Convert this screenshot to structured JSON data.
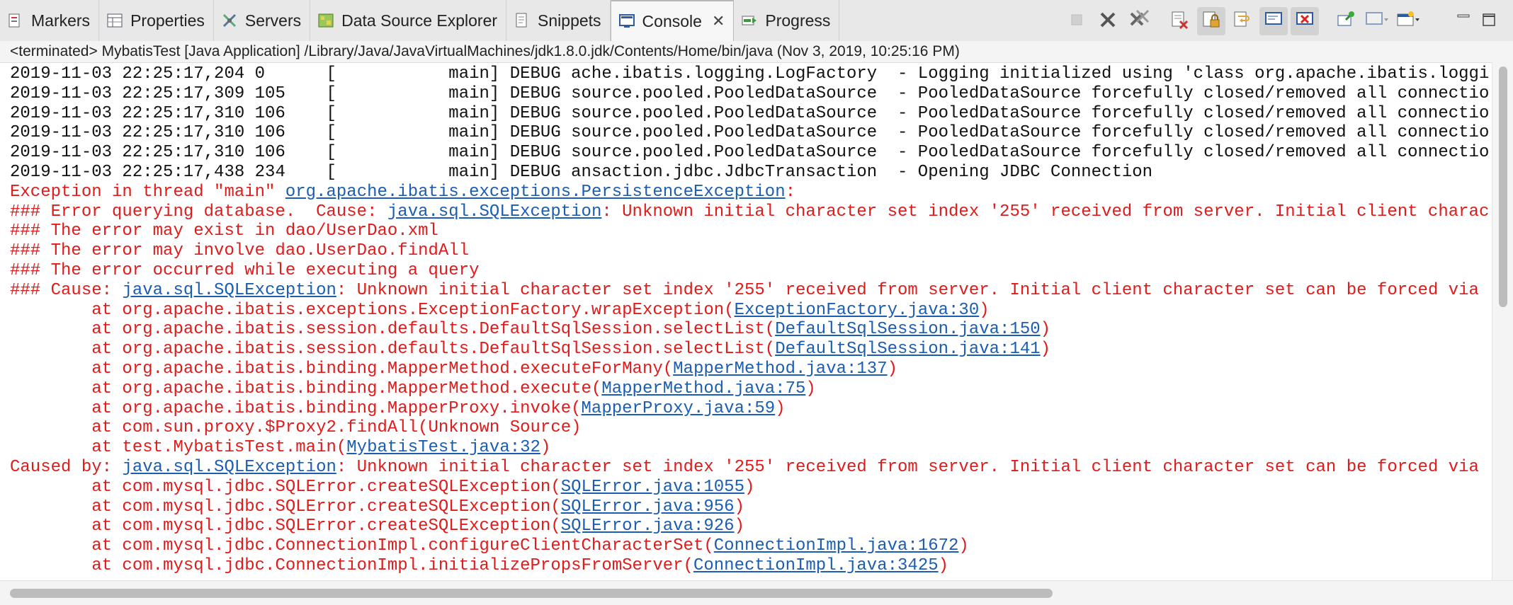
{
  "tabs": [
    {
      "label": "Markers",
      "icon": "markers-icon"
    },
    {
      "label": "Properties",
      "icon": "properties-icon"
    },
    {
      "label": "Servers",
      "icon": "servers-icon"
    },
    {
      "label": "Data Source Explorer",
      "icon": "data-source-icon"
    },
    {
      "label": "Snippets",
      "icon": "snippets-icon"
    },
    {
      "label": "Console",
      "icon": "console-icon",
      "active": true,
      "close": "✕"
    },
    {
      "label": "Progress",
      "icon": "progress-icon"
    }
  ],
  "status": "<terminated> MybatisTest [Java Application] /Library/Java/JavaVirtualMachines/jdk1.8.0.jdk/Contents/Home/bin/java (Nov 3, 2019, 10:25:16 PM)",
  "console_lines": [
    [
      {
        "t": "2019-11-03 22:25:17,204 0      [           main] DEBUG ache.ibatis.logging.LogFactory  - Logging initialized using 'class org.apache.ibatis.loggi",
        "c": "dbg"
      }
    ],
    [
      {
        "t": "2019-11-03 22:25:17,309 105    [           main] DEBUG source.pooled.PooledDataSource  - PooledDataSource forcefully closed/removed all connectio",
        "c": "dbg"
      }
    ],
    [
      {
        "t": "2019-11-03 22:25:17,310 106    [           main] DEBUG source.pooled.PooledDataSource  - PooledDataSource forcefully closed/removed all connectio",
        "c": "dbg"
      }
    ],
    [
      {
        "t": "2019-11-03 22:25:17,310 106    [           main] DEBUG source.pooled.PooledDataSource  - PooledDataSource forcefully closed/removed all connectio",
        "c": "dbg"
      }
    ],
    [
      {
        "t": "2019-11-03 22:25:17,310 106    [           main] DEBUG source.pooled.PooledDataSource  - PooledDataSource forcefully closed/removed all connectio",
        "c": "dbg"
      }
    ],
    [
      {
        "t": "2019-11-03 22:25:17,438 234    [           main] DEBUG ansaction.jdbc.JdbcTransaction  - Opening JDBC Connection",
        "c": "dbg"
      }
    ],
    [
      {
        "t": "Exception in thread \"main\" ",
        "c": "err"
      },
      {
        "t": "org.apache.ibatis.exceptions.PersistenceException",
        "c": "lnk"
      },
      {
        "t": ":",
        "c": "err"
      }
    ],
    [
      {
        "t": "### Error querying database.  Cause: ",
        "c": "err"
      },
      {
        "t": "java.sql.SQLException",
        "c": "lnk"
      },
      {
        "t": ": Unknown initial character set index '255' received from server. Initial client charac",
        "c": "err"
      }
    ],
    [
      {
        "t": "### The error may exist in dao/UserDao.xml",
        "c": "err"
      }
    ],
    [
      {
        "t": "### The error may involve dao.UserDao.findAll",
        "c": "err"
      }
    ],
    [
      {
        "t": "### The error occurred while executing a query",
        "c": "err"
      }
    ],
    [
      {
        "t": "### Cause: ",
        "c": "err"
      },
      {
        "t": "java.sql.SQLException",
        "c": "lnk"
      },
      {
        "t": ": Unknown initial character set index '255' received from server. Initial client character set can be forced via",
        "c": "err"
      }
    ],
    [
      {
        "t": "\tat org.apache.ibatis.exceptions.ExceptionFactory.wrapException(",
        "c": "err"
      },
      {
        "t": "ExceptionFactory.java:30",
        "c": "lnk"
      },
      {
        "t": ")",
        "c": "err"
      }
    ],
    [
      {
        "t": "\tat org.apache.ibatis.session.defaults.DefaultSqlSession.selectList(",
        "c": "err"
      },
      {
        "t": "DefaultSqlSession.java:150",
        "c": "lnk"
      },
      {
        "t": ")",
        "c": "err"
      }
    ],
    [
      {
        "t": "\tat org.apache.ibatis.session.defaults.DefaultSqlSession.selectList(",
        "c": "err"
      },
      {
        "t": "DefaultSqlSession.java:141",
        "c": "lnk"
      },
      {
        "t": ")",
        "c": "err"
      }
    ],
    [
      {
        "t": "\tat org.apache.ibatis.binding.MapperMethod.executeForMany(",
        "c": "err"
      },
      {
        "t": "MapperMethod.java:137",
        "c": "lnk"
      },
      {
        "t": ")",
        "c": "err"
      }
    ],
    [
      {
        "t": "\tat org.apache.ibatis.binding.MapperMethod.execute(",
        "c": "err"
      },
      {
        "t": "MapperMethod.java:75",
        "c": "lnk"
      },
      {
        "t": ")",
        "c": "err"
      }
    ],
    [
      {
        "t": "\tat org.apache.ibatis.binding.MapperProxy.invoke(",
        "c": "err"
      },
      {
        "t": "MapperProxy.java:59",
        "c": "lnk"
      },
      {
        "t": ")",
        "c": "err"
      }
    ],
    [
      {
        "t": "\tat com.sun.proxy.$Proxy2.findAll(Unknown Source)",
        "c": "err"
      }
    ],
    [
      {
        "t": "\tat test.MybatisTest.main(",
        "c": "err"
      },
      {
        "t": "MybatisTest.java:32",
        "c": "lnk"
      },
      {
        "t": ")",
        "c": "err"
      }
    ],
    [
      {
        "t": "Caused by: ",
        "c": "err"
      },
      {
        "t": "java.sql.SQLException",
        "c": "lnk"
      },
      {
        "t": ": Unknown initial character set index '255' received from server. Initial client character set can be forced via",
        "c": "err"
      }
    ],
    [
      {
        "t": "\tat com.mysql.jdbc.SQLError.createSQLException(",
        "c": "err"
      },
      {
        "t": "SQLError.java:1055",
        "c": "lnk"
      },
      {
        "t": ")",
        "c": "err"
      }
    ],
    [
      {
        "t": "\tat com.mysql.jdbc.SQLError.createSQLException(",
        "c": "err"
      },
      {
        "t": "SQLError.java:956",
        "c": "lnk"
      },
      {
        "t": ")",
        "c": "err"
      }
    ],
    [
      {
        "t": "\tat com.mysql.jdbc.SQLError.createSQLException(",
        "c": "err"
      },
      {
        "t": "SQLError.java:926",
        "c": "lnk"
      },
      {
        "t": ")",
        "c": "err"
      }
    ],
    [
      {
        "t": "\tat com.mysql.jdbc.ConnectionImpl.configureClientCharacterSet(",
        "c": "err"
      },
      {
        "t": "ConnectionImpl.java:1672",
        "c": "lnk"
      },
      {
        "t": ")",
        "c": "err"
      }
    ],
    [
      {
        "t": "\tat com.mysql.jdbc.ConnectionImpl.initializePropsFromServer(",
        "c": "err"
      },
      {
        "t": "ConnectionImpl.java:3425",
        "c": "lnk"
      },
      {
        "t": ")",
        "c": "err"
      }
    ]
  ],
  "colors": {
    "error": "#e01b1b",
    "link": "#1a5db3",
    "debug": "#111111"
  }
}
